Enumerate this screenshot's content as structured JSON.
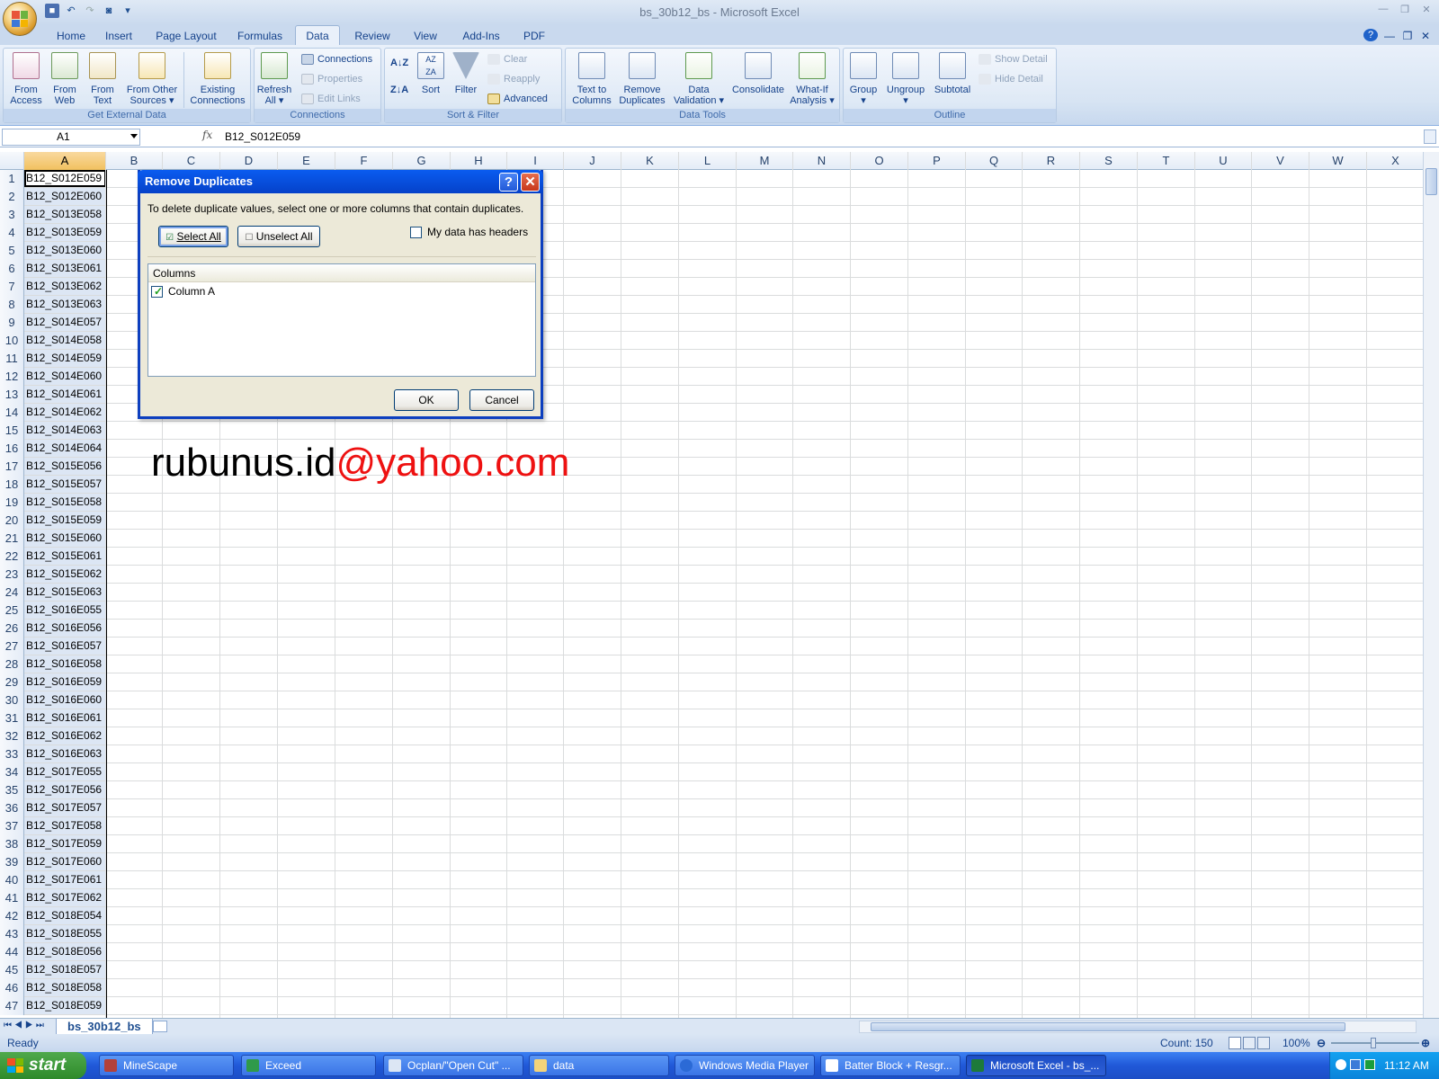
{
  "window": {
    "title": "bs_30b12_bs - Microsoft Excel"
  },
  "tabs": [
    "Home",
    "Insert",
    "Page Layout",
    "Formulas",
    "Data",
    "Review",
    "View",
    "Add-Ins",
    "PDF"
  ],
  "active_tab": "Data",
  "ribbon": {
    "get_external_data": {
      "title": "Get External Data",
      "from_access": "From\nAccess",
      "from_web": "From\nWeb",
      "from_text": "From\nText",
      "from_other": "From Other\nSources ▾",
      "existing": "Existing\nConnections"
    },
    "connections": {
      "title": "Connections",
      "refresh": "Refresh\nAll ▾",
      "connections": "Connections",
      "properties": "Properties",
      "edit_links": "Edit Links"
    },
    "sort_filter": {
      "title": "Sort & Filter",
      "sort": "Sort",
      "filter": "Filter",
      "clear": "Clear",
      "reapply": "Reapply",
      "advanced": "Advanced"
    },
    "data_tools": {
      "title": "Data Tools",
      "text_to_columns": "Text to\nColumns",
      "remove_duplicates": "Remove\nDuplicates",
      "data_validation": "Data\nValidation ▾",
      "consolidate": "Consolidate",
      "what_if": "What-If\nAnalysis ▾"
    },
    "outline": {
      "title": "Outline",
      "group": "Group\n▾",
      "ungroup": "Ungroup\n▾",
      "subtotal": "Subtotal",
      "show_detail": "Show Detail",
      "hide_detail": "Hide Detail"
    }
  },
  "formula_bar": {
    "name_box": "A1",
    "fx": "fx",
    "formula": "B12_S012E059"
  },
  "columns": [
    "A",
    "B",
    "C",
    "D",
    "E",
    "F",
    "G",
    "H",
    "I",
    "J",
    "K",
    "L",
    "M",
    "N",
    "O",
    "P",
    "Q",
    "R",
    "S",
    "T",
    "U",
    "V",
    "W",
    "X"
  ],
  "rows": [
    {
      "n": "1",
      "a": "B12_S012E059"
    },
    {
      "n": "2",
      "a": "B12_S012E060"
    },
    {
      "n": "3",
      "a": "B12_S013E058"
    },
    {
      "n": "4",
      "a": "B12_S013E059"
    },
    {
      "n": "5",
      "a": "B12_S013E060"
    },
    {
      "n": "6",
      "a": "B12_S013E061"
    },
    {
      "n": "7",
      "a": "B12_S013E062"
    },
    {
      "n": "8",
      "a": "B12_S013E063"
    },
    {
      "n": "9",
      "a": "B12_S014E057"
    },
    {
      "n": "10",
      "a": "B12_S014E058"
    },
    {
      "n": "11",
      "a": "B12_S014E059"
    },
    {
      "n": "12",
      "a": "B12_S014E060"
    },
    {
      "n": "13",
      "a": "B12_S014E061"
    },
    {
      "n": "14",
      "a": "B12_S014E062"
    },
    {
      "n": "15",
      "a": "B12_S014E063"
    },
    {
      "n": "16",
      "a": "B12_S014E064"
    },
    {
      "n": "17",
      "a": "B12_S015E056"
    },
    {
      "n": "18",
      "a": "B12_S015E057"
    },
    {
      "n": "19",
      "a": "B12_S015E058"
    },
    {
      "n": "20",
      "a": "B12_S015E059"
    },
    {
      "n": "21",
      "a": "B12_S015E060"
    },
    {
      "n": "22",
      "a": "B12_S015E061"
    },
    {
      "n": "23",
      "a": "B12_S015E062"
    },
    {
      "n": "24",
      "a": "B12_S015E063"
    },
    {
      "n": "25",
      "a": "B12_S016E055"
    },
    {
      "n": "26",
      "a": "B12_S016E056"
    },
    {
      "n": "27",
      "a": "B12_S016E057"
    },
    {
      "n": "28",
      "a": "B12_S016E058"
    },
    {
      "n": "29",
      "a": "B12_S016E059"
    },
    {
      "n": "30",
      "a": "B12_S016E060"
    },
    {
      "n": "31",
      "a": "B12_S016E061"
    },
    {
      "n": "32",
      "a": "B12_S016E062"
    },
    {
      "n": "33",
      "a": "B12_S016E063"
    },
    {
      "n": "34",
      "a": "B12_S017E055"
    },
    {
      "n": "35",
      "a": "B12_S017E056"
    },
    {
      "n": "36",
      "a": "B12_S017E057"
    },
    {
      "n": "37",
      "a": "B12_S017E058"
    },
    {
      "n": "38",
      "a": "B12_S017E059"
    },
    {
      "n": "39",
      "a": "B12_S017E060"
    },
    {
      "n": "40",
      "a": "B12_S017E061"
    },
    {
      "n": "41",
      "a": "B12_S017E062"
    },
    {
      "n": "42",
      "a": "B12_S018E054"
    },
    {
      "n": "43",
      "a": "B12_S018E055"
    },
    {
      "n": "44",
      "a": "B12_S018E056"
    },
    {
      "n": "45",
      "a": "B12_S018E057"
    },
    {
      "n": "46",
      "a": "B12_S018E058"
    },
    {
      "n": "47",
      "a": "B12_S018E059"
    }
  ],
  "sheet_tab": "bs_30b12_bs",
  "status": {
    "ready": "Ready",
    "count": "Count: 150",
    "zoom": "100%"
  },
  "dialog": {
    "title": "Remove Duplicates",
    "description": "To delete duplicate values, select one or more columns that contain duplicates.",
    "select_all": "Select All",
    "unselect_all": "Unselect All",
    "headers_label": "My data has headers",
    "headers_checked": false,
    "columns_header": "Columns",
    "column_item": "Column A",
    "column_checked": true,
    "ok": "OK",
    "cancel": "Cancel"
  },
  "watermark": {
    "user": "rubunus.id",
    "domain": "@yahoo.com"
  },
  "taskbar": {
    "start": "start",
    "items": [
      "MineScape",
      "Exceed",
      "Ocplan/\"Open Cut\"  ...",
      "data",
      "Windows Media Player",
      "Batter Block + Resgr...",
      "Microsoft Excel - bs_..."
    ],
    "clock": "11:12 AM"
  },
  "colors": {
    "ribbon_text": "#15428b",
    "dialog_title": "#0a5cf0",
    "watermark_domain": "#ee1111"
  }
}
